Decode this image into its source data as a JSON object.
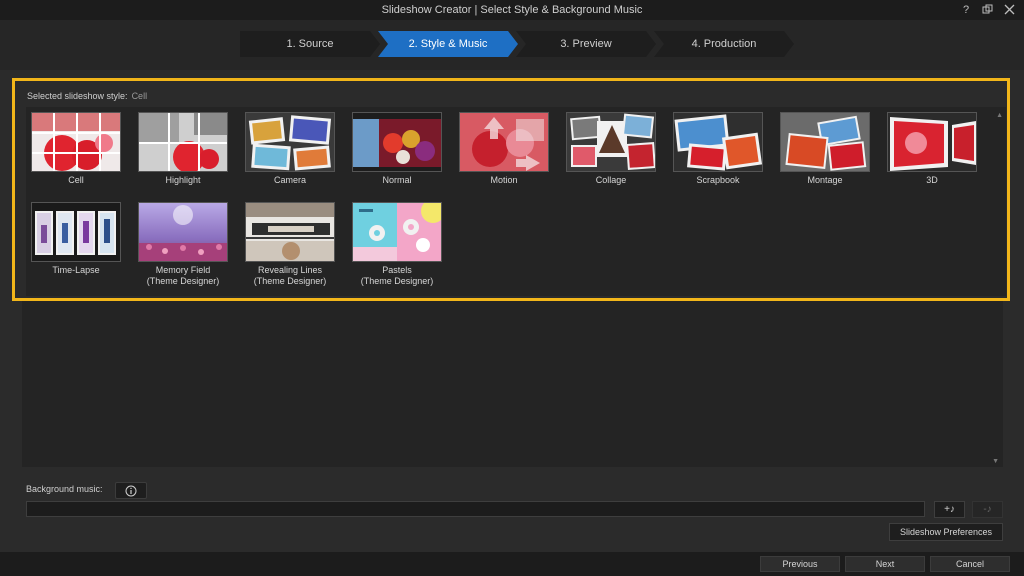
{
  "window": {
    "title": "Slideshow Creator | Select Style & Background Music",
    "help_glyph": "?",
    "colors": {
      "accent": "#1e6fc4",
      "highlight_frame": "#f2b61a"
    }
  },
  "wizard_steps": [
    {
      "label": "1. Source",
      "active": false
    },
    {
      "label": "2. Style & Music",
      "active": true
    },
    {
      "label": "3. Preview",
      "active": false
    },
    {
      "label": "4. Production",
      "active": false
    }
  ],
  "style_panel": {
    "selected_label": "Selected slideshow style:",
    "selected_value": "Cell",
    "styles": [
      {
        "label": "Cell"
      },
      {
        "label": "Highlight"
      },
      {
        "label": "Camera"
      },
      {
        "label": "Normal"
      },
      {
        "label": "Motion"
      },
      {
        "label": "Collage"
      },
      {
        "label": "Scrapbook"
      },
      {
        "label": "Montage"
      },
      {
        "label": "3D"
      },
      {
        "label": "Time-Lapse"
      },
      {
        "label": "Memory Field",
        "sublabel": "(Theme Designer)"
      },
      {
        "label": "Revealing Lines",
        "sublabel": "(Theme Designer)"
      },
      {
        "label": "Pastels",
        "sublabel": "(Theme Designer)"
      }
    ],
    "scroll_up_icon": "▲",
    "scroll_down_icon": "▼"
  },
  "music": {
    "label": "Background music:",
    "value": "",
    "info_icon": "info-icon",
    "add_icon": "add-music-icon",
    "remove_icon": "remove-music-icon",
    "add_text": "+♪",
    "remove_text": "-♪",
    "preferences_label": "Slideshow Preferences"
  },
  "footer": {
    "previous": "Previous",
    "next": "Next",
    "cancel": "Cancel"
  }
}
